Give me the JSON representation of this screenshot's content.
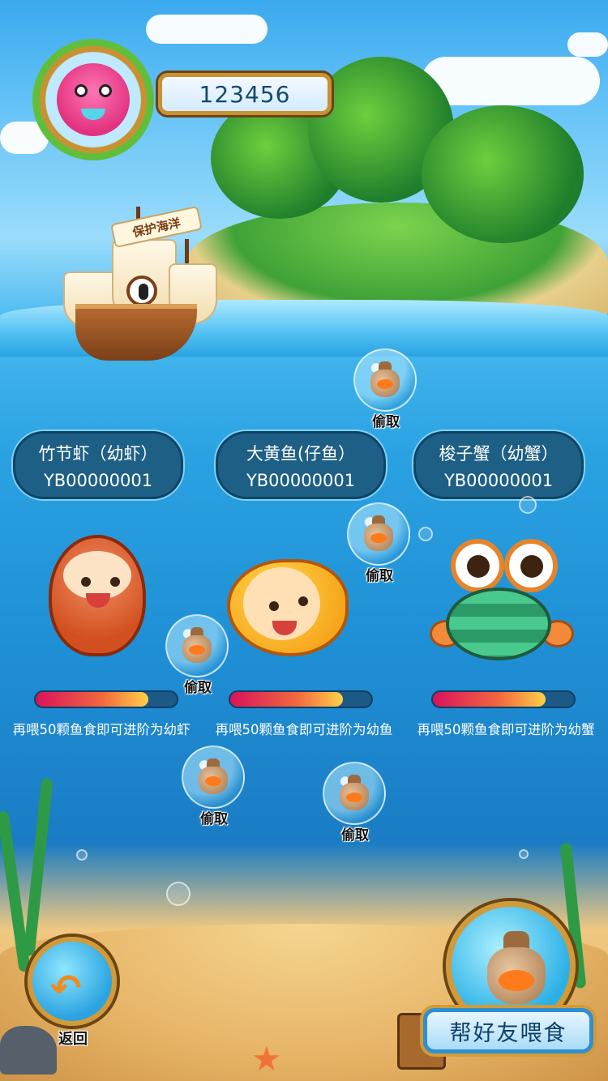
{
  "player": {
    "score": "123456",
    "avatar_icon": "pink-octopus-avatar"
  },
  "ship": {
    "banner": "保护海洋"
  },
  "steal_label": "偷取",
  "pets": [
    {
      "name": "竹节虾（幼虾）",
      "id": "YB00000001",
      "hint": "再喂50颗鱼食即可进阶为幼虾",
      "progress": 0.8
    },
    {
      "name": "大黄鱼(仔鱼）",
      "id": "YB00000001",
      "hint": "再喂50颗鱼食即可进阶为幼鱼",
      "progress": 0.8
    },
    {
      "name": "梭子蟹（幼蟹）",
      "id": "YB00000001",
      "hint": "再喂50颗鱼食即可进阶为幼蟹",
      "progress": 0.8
    }
  ],
  "buttons": {
    "back": "返回",
    "feed_friend": "帮好友喂食"
  },
  "colors": {
    "progress_start": "#d9125c",
    "progress_end": "#ffd14a",
    "label_bg": "#1e5f85",
    "frame_gold": "#d19b3a"
  }
}
